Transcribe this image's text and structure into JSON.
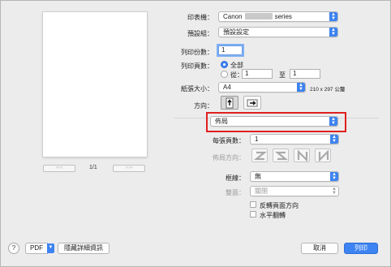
{
  "printer": {
    "label": "印表機：",
    "value_prefix": "Canon",
    "value_suffix": "series"
  },
  "presets": {
    "label": "預設組：",
    "value": "預設設定"
  },
  "copies": {
    "label": "列印份數：",
    "value": "1"
  },
  "pages": {
    "label": "列印頁數：",
    "all_label": "全部",
    "from_label": "從：",
    "from_value": "1",
    "to_label": "至",
    "to_value": "1"
  },
  "paper_size": {
    "label": "紙張大小：",
    "value": "A4",
    "dimensions": "210 x 297 公釐"
  },
  "orientation": {
    "label": "方向：",
    "selected": "portrait"
  },
  "section": {
    "value": "佈局"
  },
  "pages_per_sheet": {
    "label": "每張頁數：",
    "value": "1"
  },
  "layout_direction": {
    "label": "佈局方向："
  },
  "border": {
    "label": "框線：",
    "value": "無"
  },
  "two_sided": {
    "label": "雙面：",
    "value": "關閉"
  },
  "reverse": {
    "label": "反轉頁面方向"
  },
  "flip": {
    "label": "水平翻轉"
  },
  "preview": {
    "page_indicator": "1/1",
    "first": "<<  <",
    "next": ">  >>"
  },
  "footer": {
    "help": "?",
    "pdf": "PDF",
    "hide_details": "隱藏詳細資訊",
    "cancel": "取消",
    "print": "列印"
  },
  "colors": {
    "accent": "#3d83f1",
    "highlight": "#e02020"
  }
}
